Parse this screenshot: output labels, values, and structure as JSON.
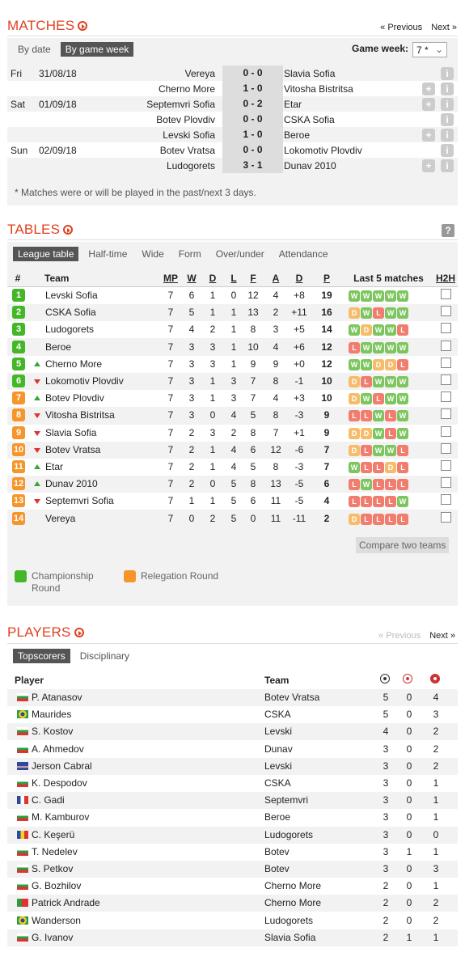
{
  "matches": {
    "title": "MATCHES",
    "pager": {
      "prev": "« Previous",
      "next": "Next »"
    },
    "tabs": [
      "By date",
      "By game week"
    ],
    "gameweek_label": "Game week:",
    "gameweek_value": "7 *",
    "rows": [
      {
        "day": "Fri",
        "date": "31/08/18",
        "home": "Vereya",
        "score": "0 - 0",
        "away": "Slavia Sofia",
        "plus": false
      },
      {
        "day": "",
        "date": "",
        "home": "Cherno More",
        "score": "1 - 0",
        "away": "Vitosha Bistritsa",
        "plus": true
      },
      {
        "day": "Sat",
        "date": "01/09/18",
        "home": "Septemvri Sofia",
        "score": "0 - 2",
        "away": "Etar",
        "plus": true
      },
      {
        "day": "",
        "date": "",
        "home": "Botev Plovdiv",
        "score": "0 - 0",
        "away": "CSKA Sofia",
        "plus": false
      },
      {
        "day": "",
        "date": "",
        "home": "Levski Sofia",
        "score": "1 - 0",
        "away": "Beroe",
        "plus": true
      },
      {
        "day": "Sun",
        "date": "02/09/18",
        "home": "Botev Vratsa",
        "score": "0 - 0",
        "away": "Lokomotiv Plovdiv",
        "plus": false
      },
      {
        "day": "",
        "date": "",
        "home": "Ludogorets",
        "score": "3 - 1",
        "away": "Dunav 2010",
        "plus": true
      }
    ],
    "note": "* Matches were or will be played in the past/next 3 days."
  },
  "tables": {
    "title": "TABLES",
    "tabs": [
      "League table",
      "Half-time",
      "Wide",
      "Form",
      "Over/under",
      "Attendance"
    ],
    "headers": {
      "pos": "#",
      "team": "Team",
      "mp": "MP",
      "w": "W",
      "d": "D",
      "l": "L",
      "f": "F",
      "a": "A",
      "gd": "D",
      "p": "P",
      "last5": "Last 5 matches",
      "h2h": "H2H"
    },
    "colors": {
      "green": "#44b728",
      "orange": "#f6952b",
      "W": "#7dc65f",
      "D": "#f5bd6b",
      "L": "#f07d6d"
    },
    "rows": [
      {
        "pos": "1",
        "zone": "green",
        "trend": "",
        "team": "Levski Sofia",
        "mp": "7",
        "w": "6",
        "d": "1",
        "l": "0",
        "f": "12",
        "a": "4",
        "gd": "+8",
        "p": "19",
        "form": [
          "W",
          "W",
          "W",
          "W",
          "W"
        ]
      },
      {
        "pos": "2",
        "zone": "green",
        "trend": "",
        "team": "CSKA Sofia",
        "mp": "7",
        "w": "5",
        "d": "1",
        "l": "1",
        "f": "13",
        "a": "2",
        "gd": "+11",
        "p": "16",
        "form": [
          "D",
          "W",
          "L",
          "W",
          "W"
        ]
      },
      {
        "pos": "3",
        "zone": "green",
        "trend": "",
        "team": "Ludogorets",
        "mp": "7",
        "w": "4",
        "d": "2",
        "l": "1",
        "f": "8",
        "a": "3",
        "gd": "+5",
        "p": "14",
        "form": [
          "W",
          "D",
          "W",
          "W",
          "L"
        ]
      },
      {
        "pos": "4",
        "zone": "green",
        "trend": "",
        "team": "Beroe",
        "mp": "7",
        "w": "3",
        "d": "3",
        "l": "1",
        "f": "10",
        "a": "4",
        "gd": "+6",
        "p": "12",
        "form": [
          "L",
          "W",
          "W",
          "W",
          "W"
        ]
      },
      {
        "pos": "5",
        "zone": "green",
        "trend": "up",
        "team": "Cherno More",
        "mp": "7",
        "w": "3",
        "d": "3",
        "l": "1",
        "f": "9",
        "a": "9",
        "gd": "+0",
        "p": "12",
        "form": [
          "W",
          "W",
          "D",
          "D",
          "L"
        ]
      },
      {
        "pos": "6",
        "zone": "green",
        "trend": "down",
        "team": "Lokomotiv Plovdiv",
        "mp": "7",
        "w": "3",
        "d": "1",
        "l": "3",
        "f": "7",
        "a": "8",
        "gd": "-1",
        "p": "10",
        "form": [
          "D",
          "L",
          "W",
          "W",
          "W"
        ]
      },
      {
        "pos": "7",
        "zone": "orange",
        "trend": "up",
        "team": "Botev Plovdiv",
        "mp": "7",
        "w": "3",
        "d": "1",
        "l": "3",
        "f": "7",
        "a": "4",
        "gd": "+3",
        "p": "10",
        "form": [
          "D",
          "W",
          "L",
          "W",
          "W"
        ]
      },
      {
        "pos": "8",
        "zone": "orange",
        "trend": "down",
        "team": "Vitosha Bistritsa",
        "mp": "7",
        "w": "3",
        "d": "0",
        "l": "4",
        "f": "5",
        "a": "8",
        "gd": "-3",
        "p": "9",
        "form": [
          "L",
          "L",
          "W",
          "L",
          "W"
        ]
      },
      {
        "pos": "9",
        "zone": "orange",
        "trend": "down",
        "team": "Slavia Sofia",
        "mp": "7",
        "w": "2",
        "d": "3",
        "l": "2",
        "f": "8",
        "a": "7",
        "gd": "+1",
        "p": "9",
        "form": [
          "D",
          "D",
          "W",
          "L",
          "W"
        ]
      },
      {
        "pos": "10",
        "zone": "orange",
        "trend": "down",
        "team": "Botev Vratsa",
        "mp": "7",
        "w": "2",
        "d": "1",
        "l": "4",
        "f": "6",
        "a": "12",
        "gd": "-6",
        "p": "7",
        "form": [
          "D",
          "L",
          "W",
          "W",
          "L"
        ]
      },
      {
        "pos": "11",
        "zone": "orange",
        "trend": "up",
        "team": "Etar",
        "mp": "7",
        "w": "2",
        "d": "1",
        "l": "4",
        "f": "5",
        "a": "8",
        "gd": "-3",
        "p": "7",
        "form": [
          "W",
          "L",
          "L",
          "D",
          "L"
        ]
      },
      {
        "pos": "12",
        "zone": "orange",
        "trend": "up",
        "team": "Dunav 2010",
        "mp": "7",
        "w": "2",
        "d": "0",
        "l": "5",
        "f": "8",
        "a": "13",
        "gd": "-5",
        "p": "6",
        "form": [
          "L",
          "W",
          "L",
          "L",
          "L"
        ]
      },
      {
        "pos": "13",
        "zone": "orange",
        "trend": "down",
        "team": "Septemvri Sofia",
        "mp": "7",
        "w": "1",
        "d": "1",
        "l": "5",
        "f": "6",
        "a": "11",
        "gd": "-5",
        "p": "4",
        "form": [
          "L",
          "L",
          "L",
          "L",
          "W"
        ]
      },
      {
        "pos": "14",
        "zone": "orange",
        "trend": "",
        "team": "Vereya",
        "mp": "7",
        "w": "0",
        "d": "2",
        "l": "5",
        "f": "0",
        "a": "11",
        "gd": "-11",
        "p": "2",
        "form": [
          "D",
          "L",
          "L",
          "L",
          "L"
        ]
      }
    ],
    "compare_button": "Compare two teams",
    "legend": [
      {
        "zone": "green",
        "label": "Championship Round"
      },
      {
        "zone": "orange",
        "label": "Relegation Round"
      }
    ]
  },
  "players": {
    "title": "PLAYERS",
    "pager": {
      "prev": "« Previous",
      "next": "Next »"
    },
    "tabs": [
      "Topscorers",
      "Disciplinary"
    ],
    "headers": {
      "player": "Player",
      "team": "Team"
    },
    "rows": [
      {
        "flag": "bg",
        "name": "P. Atanasov",
        "team": "Botev Vratsa",
        "g": "5",
        "p": "0",
        "c": "4"
      },
      {
        "flag": "br",
        "name": "Maurides",
        "team": "CSKA",
        "g": "5",
        "p": "0",
        "c": "3"
      },
      {
        "flag": "bg",
        "name": "S. Kostov",
        "team": "Levski",
        "g": "4",
        "p": "0",
        "c": "2"
      },
      {
        "flag": "bg",
        "name": "A. Ahmedov",
        "team": "Dunav",
        "g": "3",
        "p": "0",
        "c": "2"
      },
      {
        "flag": "cv",
        "name": "Jerson Cabral",
        "team": "Levski",
        "g": "3",
        "p": "0",
        "c": "2"
      },
      {
        "flag": "bg",
        "name": "K. Despodov",
        "team": "CSKA",
        "g": "3",
        "p": "0",
        "c": "1"
      },
      {
        "flag": "fr",
        "name": "C. Gadi",
        "team": "Septemvri",
        "g": "3",
        "p": "0",
        "c": "1"
      },
      {
        "flag": "bg",
        "name": "M. Kamburov",
        "team": "Beroe",
        "g": "3",
        "p": "0",
        "c": "1"
      },
      {
        "flag": "ro",
        "name": "C. Keşerü",
        "team": "Ludogorets",
        "g": "3",
        "p": "0",
        "c": "0"
      },
      {
        "flag": "bg",
        "name": "T. Nedelev",
        "team": "Botev",
        "g": "3",
        "p": "1",
        "c": "1"
      },
      {
        "flag": "bg",
        "name": "S. Petkov",
        "team": "Botev",
        "g": "3",
        "p": "0",
        "c": "3"
      },
      {
        "flag": "bg",
        "name": "G. Bozhilov",
        "team": "Cherno More",
        "g": "2",
        "p": "0",
        "c": "1"
      },
      {
        "flag": "pt",
        "name": "Patrick Andrade",
        "team": "Cherno More",
        "g": "2",
        "p": "0",
        "c": "2"
      },
      {
        "flag": "br",
        "name": "Wanderson",
        "team": "Ludogorets",
        "g": "2",
        "p": "0",
        "c": "2"
      },
      {
        "flag": "bg",
        "name": "G. Ivanov",
        "team": "Slavia Sofia",
        "g": "2",
        "p": "1",
        "c": "1"
      }
    ]
  }
}
